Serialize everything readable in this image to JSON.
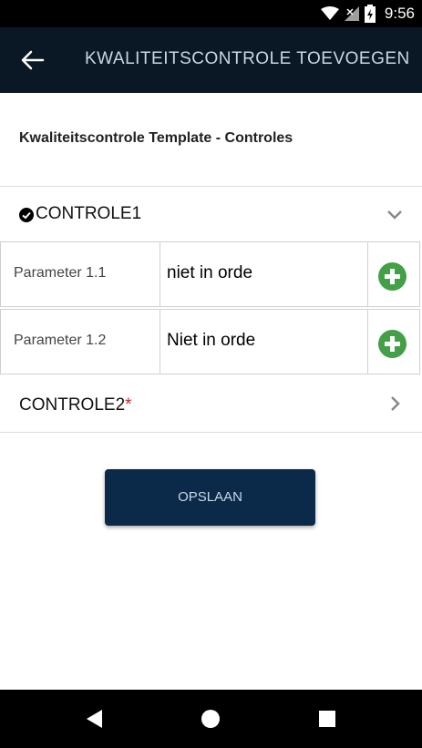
{
  "status_bar": {
    "time": "9:56",
    "icons": [
      "wifi-icon",
      "no-signal-icon",
      "battery-charging-icon"
    ]
  },
  "app_bar": {
    "title": "KWALITEITSCONTROLE TOEVOEGEN",
    "back_icon": "arrow-left-icon"
  },
  "template_title": "Kwaliteitscontrole Template - Controles",
  "sections": [
    {
      "label": "CONTROLE1",
      "checked": true,
      "expanded": true,
      "parameters": [
        {
          "name": "Parameter 1.1",
          "value": "niet in orde"
        },
        {
          "name": "Parameter 1.2",
          "value": "Niet in orde"
        }
      ]
    },
    {
      "label": "CONTROLE2",
      "required_mark": "*",
      "expanded": false
    }
  ],
  "save_button": {
    "label": "OPSLAAN"
  },
  "nav_bar": {
    "buttons": [
      "back-triangle-icon",
      "home-circle-icon",
      "recents-square-icon"
    ]
  },
  "colors": {
    "app_bar": "#0a1826",
    "button": "#0b2a4a",
    "add_green": "#43a047",
    "required_red": "#c62828"
  }
}
